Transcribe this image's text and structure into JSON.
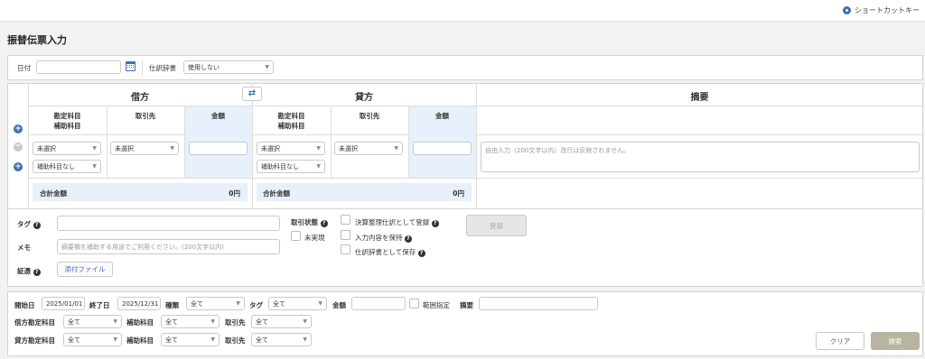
{
  "header": {
    "shortcut_label": "ショートカットキー",
    "page_title": "振替伝票入力"
  },
  "entry_form": {
    "date_label": "日付",
    "date_value": "",
    "dictionary_label": "仕訳辞書",
    "dictionary_value": "使用しない",
    "debit_title": "借方",
    "credit_title": "貸方",
    "summary_title": "摘要",
    "col_account": "勘定科目",
    "col_sub_account": "補助科目",
    "col_partner": "取引先",
    "col_amount": "金額",
    "debit_account_value": "未選択",
    "debit_sub_value": "補助科目なし",
    "debit_partner_value": "未選択",
    "credit_account_value": "未選択",
    "credit_sub_value": "補助科目なし",
    "credit_partner_value": "未選択",
    "summary_placeholder": "自由入力（200文字以内）改行は反映されません。",
    "total_label": "合計金額",
    "debit_total": "0円",
    "credit_total": "0円"
  },
  "meta_form": {
    "tag_label": "タグ",
    "memo_label": "メモ",
    "memo_placeholder": "摘要欄を補助する用途でご利用ください。(200文字以内)",
    "evidence_label": "証憑",
    "attach_button": "添付ファイル",
    "status_label": "取引状態",
    "unrealized_label": "未実現",
    "settlement_label": "決算整理仕訳として登録",
    "keep_input_label": "入力内容を保持",
    "save_dict_label": "仕訳辞書として保存",
    "register_button": "登録"
  },
  "search": {
    "start_label": "開始日",
    "start_value": "2025/01/01",
    "end_label": "終了日",
    "end_value": "2025/12/31",
    "type_label": "種類",
    "type_value": "全て",
    "tag_label": "タグ",
    "tag_value": "全て",
    "amount_label": "金額",
    "range_label": "範囲指定",
    "summary_label": "摘要",
    "debit_account_label": "借方勘定科目",
    "debit_account_value": "全て",
    "debit_sub_label": "補助科目",
    "debit_sub_value": "全て",
    "debit_partner_label": "取引先",
    "debit_partner_value": "全て",
    "credit_account_label": "貸方勘定科目",
    "credit_account_value": "全て",
    "credit_sub_label": "補助科目",
    "credit_sub_value": "全て",
    "credit_partner_label": "取引先",
    "credit_partner_value": "全て",
    "clear_button": "クリア",
    "search_button": "検索"
  },
  "colors": {
    "accent": "#3e6fb3",
    "amount_bg": "#e8f0fb"
  }
}
